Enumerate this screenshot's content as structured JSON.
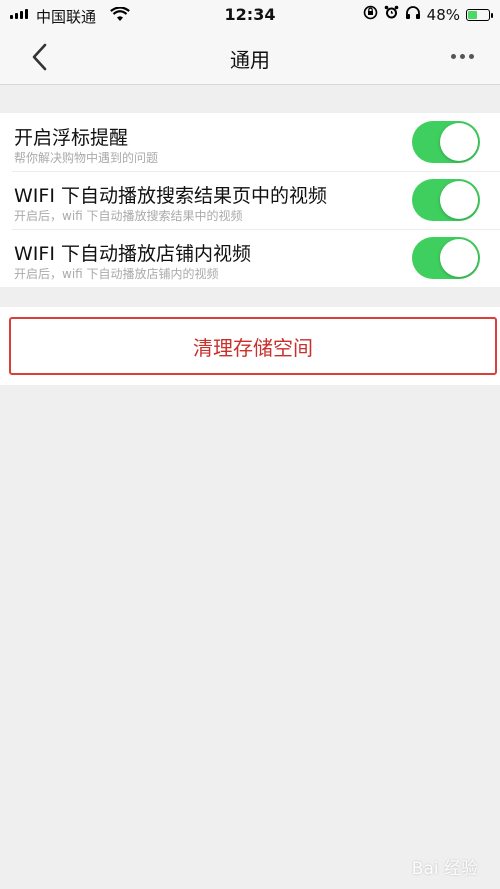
{
  "status_bar": {
    "carrier": "中国联通",
    "time": "12:34",
    "battery_percent": "48%",
    "battery_level": 0.48,
    "icons": [
      "signal-icon",
      "wifi-icon",
      "rotation-lock-icon",
      "alarm-icon",
      "headphones-icon",
      "battery-icon"
    ]
  },
  "nav": {
    "title": "通用",
    "back_icon": "chevron-left-icon",
    "more_icon": "more-dots-icon"
  },
  "settings": [
    {
      "title": "开启浮标提醒",
      "subtitle": "帮你解决购物中遇到的问题",
      "enabled": true
    },
    {
      "title": "WIFI 下自动播放搜索结果页中的视频",
      "subtitle": "开启后，wifi 下自动播放搜索结果中的视频",
      "enabled": true
    },
    {
      "title": "WIFI 下自动播放店铺内视频",
      "subtitle": "开启后，wifi 下自动播放店铺内的视频",
      "enabled": true
    }
  ],
  "clear_button": {
    "label": "清理存储空间"
  },
  "watermark": {
    "text": "Bai 经验"
  },
  "colors": {
    "toggle_on": "#3fcf5e",
    "clear_border": "#d9403a",
    "clear_text": "#c9302c",
    "background": "#efeff0"
  }
}
